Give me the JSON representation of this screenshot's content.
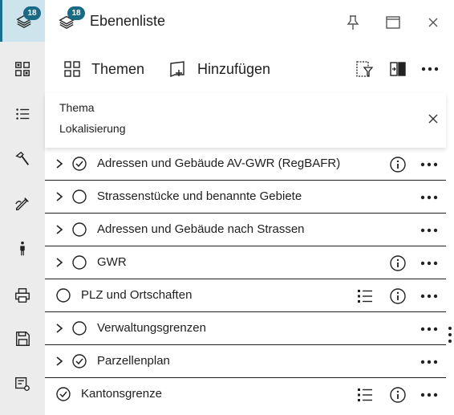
{
  "rail": {
    "items": [
      {
        "icon": "layers-icon",
        "badge": "18",
        "active": true
      },
      {
        "icon": "qr-tiles-icon"
      },
      {
        "icon": "list-icon"
      },
      {
        "icon": "hammer-icon"
      },
      {
        "icon": "pencil-ruler-icon"
      },
      {
        "icon": "person-icon"
      },
      {
        "icon": "printer-icon"
      },
      {
        "icon": "save-icon"
      },
      {
        "icon": "settings-list-icon"
      }
    ]
  },
  "header": {
    "badge": "18",
    "title": "Ebenenliste"
  },
  "toolbar": {
    "themes_label": "Themen",
    "add_label": "Hinzufügen"
  },
  "filter": {
    "line1": "Thema",
    "line2": "Lokalisierung"
  },
  "layers": [
    {
      "name": "Adressen und Gebäude AV-GWR (RegBAFR)",
      "expandable": true,
      "checked": true,
      "legend": false,
      "info": true
    },
    {
      "name": "Strassenstücke und benannte Gebiete",
      "expandable": true,
      "checked": false,
      "legend": false,
      "info": false
    },
    {
      "name": "Adressen und Gebäude nach Strassen",
      "expandable": true,
      "checked": false,
      "legend": false,
      "info": false
    },
    {
      "name": "GWR",
      "expandable": true,
      "checked": false,
      "legend": false,
      "info": true
    },
    {
      "name": "PLZ und Ortschaften",
      "expandable": false,
      "checked": false,
      "legend": true,
      "info": true
    },
    {
      "name": "Verwaltungsgrenzen",
      "expandable": true,
      "checked": false,
      "legend": false,
      "info": false
    },
    {
      "name": "Parzellenplan",
      "expandable": true,
      "checked": true,
      "legend": false,
      "info": false
    },
    {
      "name": "Kantonsgrenze",
      "expandable": false,
      "checked": true,
      "legend": true,
      "info": true
    }
  ],
  "colors": {
    "accent": "#1a6a86",
    "rail_bg": "#ececec",
    "rail_active": "#cde4ec"
  }
}
